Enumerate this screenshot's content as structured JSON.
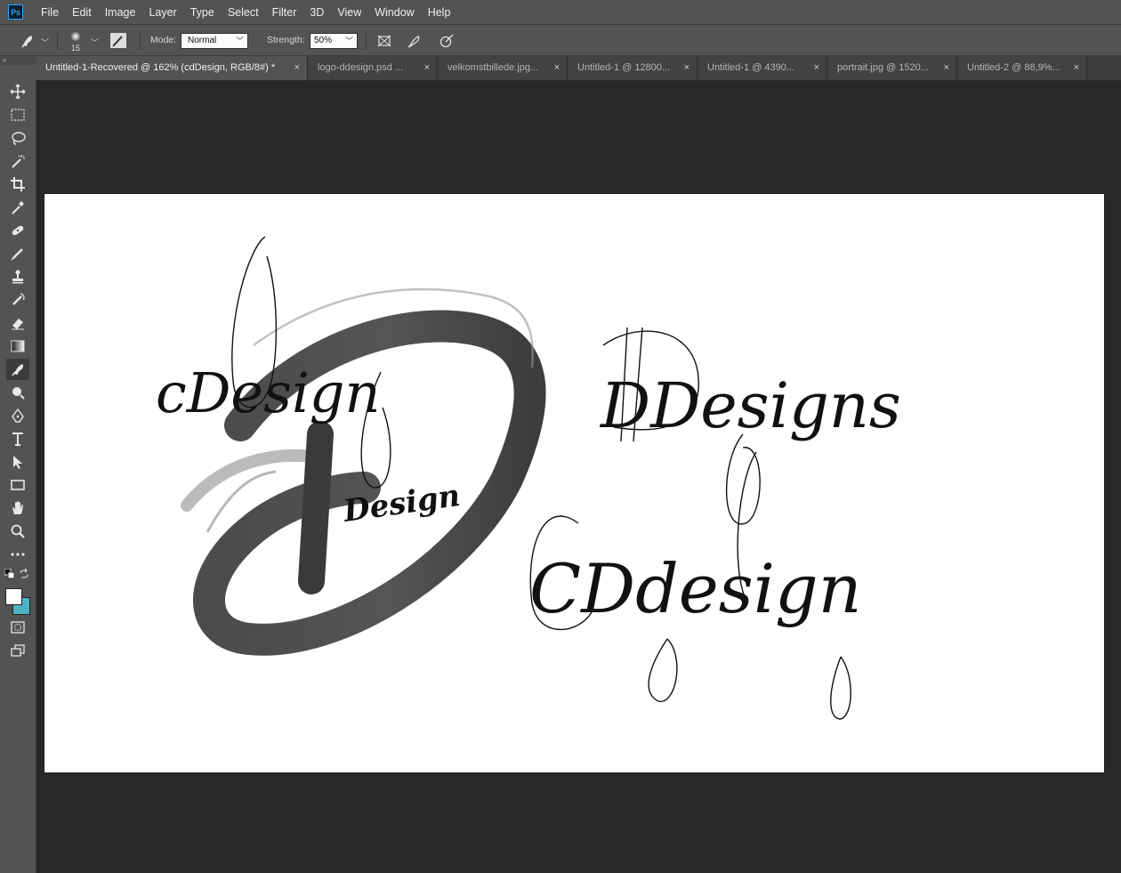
{
  "app": {
    "logo_text": "Ps",
    "accent_color": "#31a8ff"
  },
  "menu": [
    "File",
    "Edit",
    "Image",
    "Layer",
    "Type",
    "Select",
    "Filter",
    "3D",
    "View",
    "Window",
    "Help"
  ],
  "options": {
    "brush_size": "15",
    "mode_label": "Mode:",
    "mode_value": "Normal",
    "strength_label": "Strength:",
    "strength_value": "50%"
  },
  "toolbar_handle": "»",
  "tabs": [
    {
      "label": "Untitled-1-Recovered @ 162% (cdDesign, RGB/8#) *",
      "close": "×",
      "active": true
    },
    {
      "label": "logo-ddesign.psd ...",
      "close": "×",
      "active": false
    },
    {
      "label": "velkomstbillede.jpg...",
      "close": "×",
      "active": false
    },
    {
      "label": "Untitled-1 @ 12800...",
      "close": "×",
      "active": false
    },
    {
      "label": "Untitled-1 @ 4390...",
      "close": "×",
      "active": false
    },
    {
      "label": "portrait.jpg @ 1520...",
      "close": "×",
      "active": false
    },
    {
      "label": "Untitled-2 @ 88,9%...",
      "close": "×",
      "active": false
    }
  ],
  "canvas_text": {
    "left_script": "cDesign",
    "badge_text": "Design",
    "right_top": "DDesigns",
    "right_bottom": "CDdesign"
  }
}
